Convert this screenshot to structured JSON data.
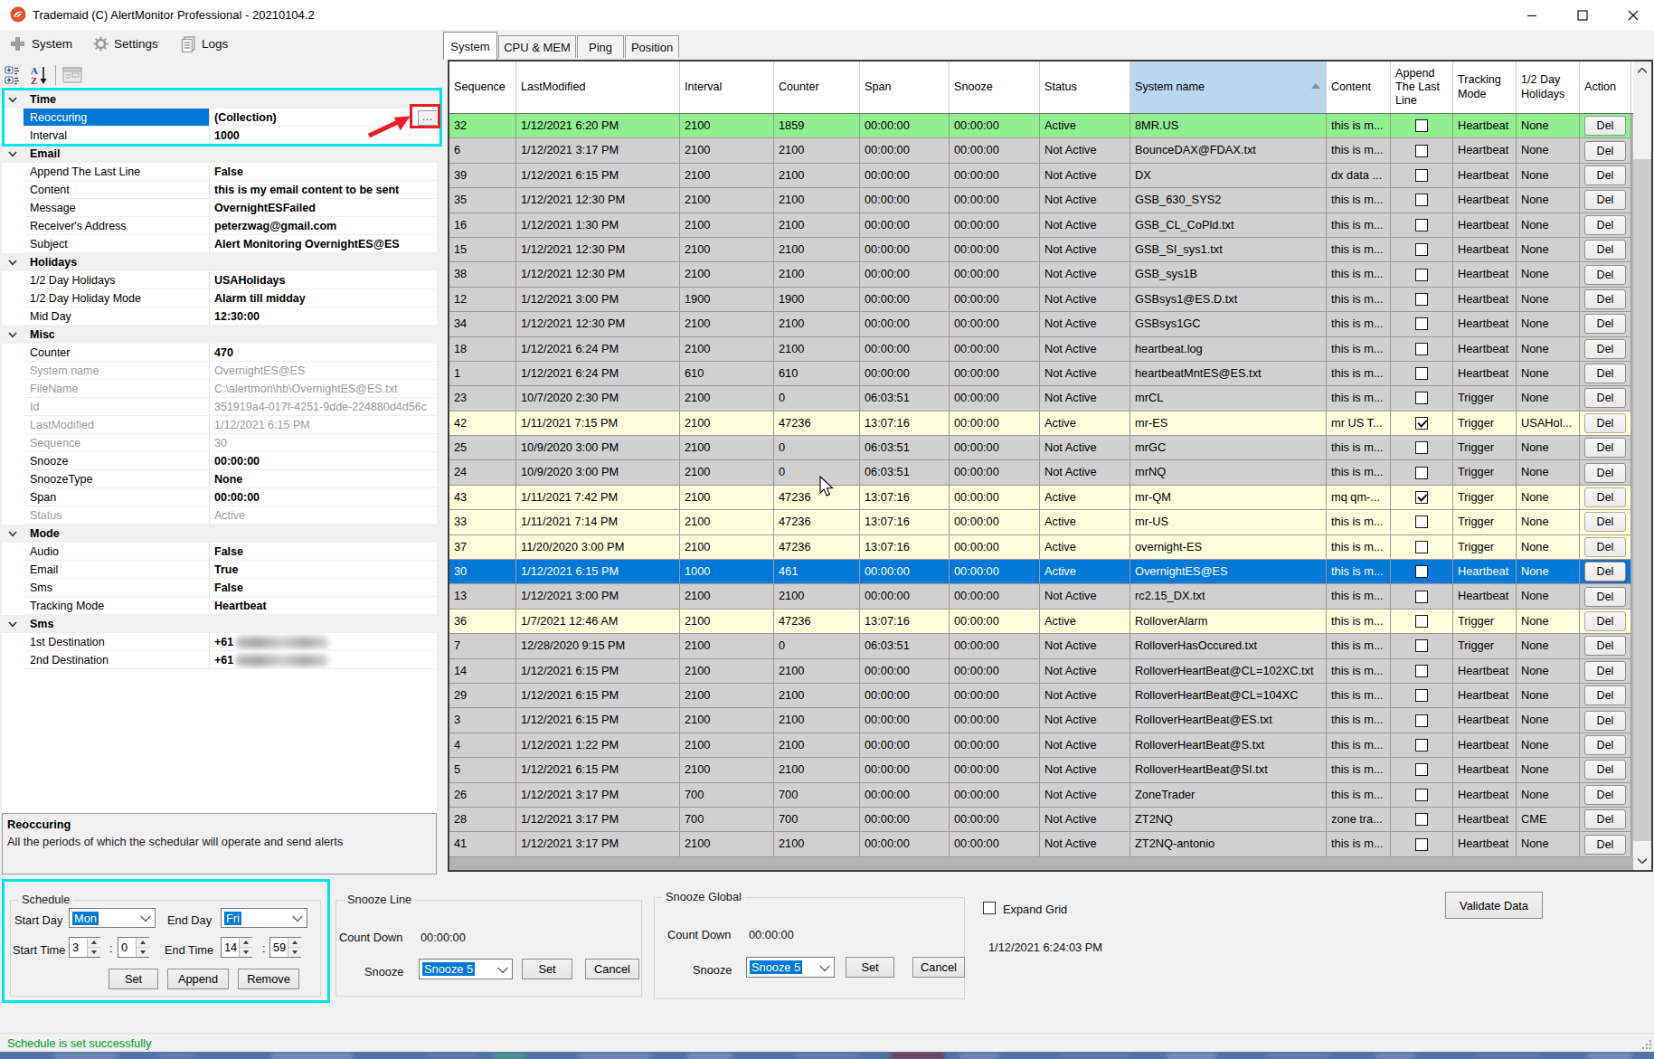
{
  "window": {
    "title": "Trademaid (C) AlertMonitor Professional - 20210104.2",
    "icon_color": "#e0512b"
  },
  "menu": {
    "items": [
      {
        "label": "System",
        "icon": "plus-icon"
      },
      {
        "label": "Settings",
        "icon": "gear-icon"
      },
      {
        "label": "Logs",
        "icon": "logs-icon"
      }
    ]
  },
  "tabs": {
    "active": "System",
    "items": [
      "System",
      "CPU & MEM",
      "Ping",
      "Position"
    ]
  },
  "property_grid": {
    "rows": [
      {
        "type": "category",
        "label": "Time"
      },
      {
        "type": "prop",
        "label": "Reoccuring",
        "value": "(Collection)",
        "bold": true,
        "selected": true,
        "ellipsis": true
      },
      {
        "type": "prop",
        "label": "Interval",
        "value": "1000",
        "bold": true
      },
      {
        "type": "category",
        "label": "Email"
      },
      {
        "type": "prop",
        "label": "Append The Last Line",
        "value": "False",
        "bold": true
      },
      {
        "type": "prop",
        "label": "Content",
        "value": "this is my email content to be sent",
        "bold": true
      },
      {
        "type": "prop",
        "label": "Message",
        "value": "OvernightESFailed",
        "bold": true
      },
      {
        "type": "prop",
        "label": "Receiver's Address",
        "value": "peterzwag@gmail.com",
        "bold": true
      },
      {
        "type": "prop",
        "label": "Subject",
        "value": "Alert Monitoring OvernightES@ES",
        "bold": true
      },
      {
        "type": "category",
        "label": "Holidays"
      },
      {
        "type": "prop",
        "label": "1/2 Day Holidays",
        "value": "USAHolidays",
        "bold": true
      },
      {
        "type": "prop",
        "label": "1/2 Day Holiday Mode",
        "value": "Alarm till midday",
        "bold": true
      },
      {
        "type": "prop",
        "label": "Mid Day",
        "value": "12:30:00",
        "bold": true
      },
      {
        "type": "category",
        "label": "Misc"
      },
      {
        "type": "prop",
        "label": "Counter",
        "value": "470",
        "bold": true
      },
      {
        "type": "prop",
        "label": "System name",
        "value": "OvernightES@ES",
        "readonly": true
      },
      {
        "type": "prop",
        "label": "FileName",
        "value": "C:\\alertmon\\hb\\OvernightES@ES.txt",
        "readonly": true
      },
      {
        "type": "prop",
        "label": "Id",
        "value": "351919a4-017f-4251-9dde-224880d4d56c",
        "readonly": true
      },
      {
        "type": "prop",
        "label": "LastModified",
        "value": "1/12/2021 6:15 PM",
        "readonly": true
      },
      {
        "type": "prop",
        "label": "Sequence",
        "value": "30",
        "readonly": true
      },
      {
        "type": "prop",
        "label": "Snooze",
        "value": "00:00:00",
        "bold": true
      },
      {
        "type": "prop",
        "label": "SnoozeType",
        "value": "None",
        "bold": true
      },
      {
        "type": "prop",
        "label": "Span",
        "value": "00:00:00",
        "bold": true
      },
      {
        "type": "prop",
        "label": "Status",
        "value": "Active",
        "readonly": true
      },
      {
        "type": "category",
        "label": "Mode"
      },
      {
        "type": "prop",
        "label": "Audio",
        "value": "False",
        "bold": true
      },
      {
        "type": "prop",
        "label": "Email",
        "value": "True",
        "bold": true
      },
      {
        "type": "prop",
        "label": "Sms",
        "value": "False",
        "bold": true
      },
      {
        "type": "prop",
        "label": "Tracking Mode",
        "value": "Heartbeat",
        "bold": true
      },
      {
        "type": "category",
        "label": "Sms"
      },
      {
        "type": "prop",
        "label": "1st Destination",
        "value": "+61",
        "bold": true,
        "masked": true
      },
      {
        "type": "prop",
        "label": "2nd Destination",
        "value": "+61",
        "bold": true,
        "masked": true
      }
    ],
    "help": {
      "title": "Reoccuring",
      "text": "All the periods of which the schedular will operate and send alerts"
    }
  },
  "grid": {
    "columns": [
      "Sequence",
      "LastModified",
      "Interval",
      "Counter",
      "Span",
      "Snooze",
      "Status",
      "System name",
      "Content",
      "Append The Last Line",
      "Tracking Mode",
      "1/2 Day Holidays",
      "Action"
    ],
    "sorted_column": "System name",
    "rows": [
      {
        "cells": [
          "32",
          "1/12/2021 6:20 PM",
          "2100",
          "1859",
          "00:00:00",
          "00:00:00",
          "Active",
          "8MR.US",
          "this is m...",
          false,
          "Heartbeat",
          "None",
          "Del"
        ],
        "color": "green"
      },
      {
        "cells": [
          "6",
          "1/12/2021 3:17 PM",
          "2100",
          "2100",
          "00:00:00",
          "00:00:00",
          "Not Active",
          "BounceDAX@FDAX.txt",
          "this is m...",
          false,
          "Heartbeat",
          "None",
          "Del"
        ],
        "color": "gray"
      },
      {
        "cells": [
          "39",
          "1/12/2021 6:15 PM",
          "2100",
          "2100",
          "00:00:00",
          "00:00:00",
          "Not Active",
          "DX",
          "dx data ...",
          false,
          "Heartbeat",
          "None",
          "Del"
        ],
        "color": "gray"
      },
      {
        "cells": [
          "35",
          "1/12/2021 12:30 PM",
          "2100",
          "2100",
          "00:00:00",
          "00:00:00",
          "Not Active",
          "GSB_630_SYS2",
          "this is m...",
          false,
          "Heartbeat",
          "None",
          "Del"
        ],
        "color": "gray"
      },
      {
        "cells": [
          "16",
          "1/12/2021 1:30 PM",
          "2100",
          "2100",
          "00:00:00",
          "00:00:00",
          "Not Active",
          "GSB_CL_CoPld.txt",
          "this is m...",
          false,
          "Heartbeat",
          "None",
          "Del"
        ],
        "color": "gray"
      },
      {
        "cells": [
          "15",
          "1/12/2021 12:30 PM",
          "2100",
          "2100",
          "00:00:00",
          "00:00:00",
          "Not Active",
          "GSB_SI_sys1.txt",
          "this is m...",
          false,
          "Heartbeat",
          "None",
          "Del"
        ],
        "color": "gray"
      },
      {
        "cells": [
          "38",
          "1/12/2021 12:30 PM",
          "2100",
          "2100",
          "00:00:00",
          "00:00:00",
          "Not Active",
          "GSB_sys1B",
          "this is m...",
          false,
          "Heartbeat",
          "None",
          "Del"
        ],
        "color": "gray"
      },
      {
        "cells": [
          "12",
          "1/12/2021 3:00 PM",
          "1900",
          "1900",
          "00:00:00",
          "00:00:00",
          "Not Active",
          "GSBsys1@ES.D.txt",
          "this is m...",
          false,
          "Heartbeat",
          "None",
          "Del"
        ],
        "color": "gray"
      },
      {
        "cells": [
          "34",
          "1/12/2021 12:30 PM",
          "2100",
          "2100",
          "00:00:00",
          "00:00:00",
          "Not Active",
          "GSBsys1GC",
          "this is m...",
          false,
          "Heartbeat",
          "None",
          "Del"
        ],
        "color": "gray"
      },
      {
        "cells": [
          "18",
          "1/12/2021 6:24 PM",
          "2100",
          "2100",
          "00:00:00",
          "00:00:00",
          "Not Active",
          "heartbeat.log",
          "this is m...",
          false,
          "Heartbeat",
          "None",
          "Del"
        ],
        "color": "gray"
      },
      {
        "cells": [
          "1",
          "1/12/2021 6:24 PM",
          "610",
          "610",
          "00:00:00",
          "00:00:00",
          "Not Active",
          "heartbeatMntES@ES.txt",
          "this is m...",
          false,
          "Heartbeat",
          "None",
          "Del"
        ],
        "color": "gray"
      },
      {
        "cells": [
          "23",
          "10/7/2020 2:30 PM",
          "2100",
          "0",
          "06:03:51",
          "00:00:00",
          "Not Active",
          "mrCL",
          "this is m...",
          false,
          "Trigger",
          "None",
          "Del"
        ],
        "color": "gray"
      },
      {
        "cells": [
          "42",
          "1/11/2021 7:15 PM",
          "2100",
          "47236",
          "13:07:16",
          "00:00:00",
          "Active",
          "mr-ES",
          "mr US T...",
          true,
          "Trigger",
          "USAHol...",
          "Del"
        ],
        "color": "yellow"
      },
      {
        "cells": [
          "25",
          "10/9/2020 3:00 PM",
          "2100",
          "0",
          "06:03:51",
          "00:00:00",
          "Not Active",
          "mrGC",
          "this is m...",
          false,
          "Trigger",
          "None",
          "Del"
        ],
        "color": "gray"
      },
      {
        "cells": [
          "24",
          "10/9/2020 3:00 PM",
          "2100",
          "0",
          "06:03:51",
          "00:00:00",
          "Not Active",
          "mrNQ",
          "this is m...",
          false,
          "Trigger",
          "None",
          "Del"
        ],
        "color": "gray"
      },
      {
        "cells": [
          "43",
          "1/11/2021 7:42 PM",
          "2100",
          "47236",
          "13:07:16",
          "00:00:00",
          "Active",
          "mr-QM",
          "mq qm-...",
          true,
          "Trigger",
          "None",
          "Del"
        ],
        "color": "yellow"
      },
      {
        "cells": [
          "33",
          "1/11/2021 7:14 PM",
          "2100",
          "47236",
          "13:07:16",
          "00:00:00",
          "Active",
          "mr-US",
          "this is m...",
          false,
          "Trigger",
          "None",
          "Del"
        ],
        "color": "yellow"
      },
      {
        "cells": [
          "37",
          "11/20/2020 3:00 PM",
          "2100",
          "47236",
          "13:07:16",
          "00:00:00",
          "Active",
          "overnight-ES",
          "this is m...",
          false,
          "Trigger",
          "None",
          "Del"
        ],
        "color": "yellow"
      },
      {
        "cells": [
          "30",
          "1/12/2021 6:15 PM",
          "1000",
          "461",
          "00:00:00",
          "00:00:00",
          "Active",
          "OvernightES@ES",
          "this is m...",
          false,
          "Heartbeat",
          "None",
          "Del"
        ],
        "color": "selected"
      },
      {
        "cells": [
          "13",
          "1/12/2021 3:00 PM",
          "2100",
          "2100",
          "00:00:00",
          "00:00:00",
          "Not Active",
          "rc2.15_DX.txt",
          "this is m...",
          false,
          "Heartbeat",
          "None",
          "Del"
        ],
        "color": "gray"
      },
      {
        "cells": [
          "36",
          "1/7/2021 12:46 AM",
          "2100",
          "47236",
          "13:07:16",
          "00:00:00",
          "Active",
          "RolloverAlarm",
          "this is m...",
          false,
          "Trigger",
          "None",
          "Del"
        ],
        "color": "yellow"
      },
      {
        "cells": [
          "7",
          "12/28/2020 9:15 PM",
          "2100",
          "0",
          "06:03:51",
          "00:00:00",
          "Not Active",
          "RolloverHasOccured.txt",
          "this is m...",
          false,
          "Trigger",
          "None",
          "Del"
        ],
        "color": "gray"
      },
      {
        "cells": [
          "14",
          "1/12/2021 6:15 PM",
          "2100",
          "2100",
          "00:00:00",
          "00:00:00",
          "Not Active",
          "RolloverHeartBeat@CL=102XC.txt",
          "this is m...",
          false,
          "Heartbeat",
          "None",
          "Del"
        ],
        "color": "gray"
      },
      {
        "cells": [
          "29",
          "1/12/2021 6:15 PM",
          "2100",
          "2100",
          "00:00:00",
          "00:00:00",
          "Not Active",
          "RolloverHeartBeat@CL=104XC",
          "this is m...",
          false,
          "Heartbeat",
          "None",
          "Del"
        ],
        "color": "gray"
      },
      {
        "cells": [
          "3",
          "1/12/2021 6:15 PM",
          "2100",
          "2100",
          "00:00:00",
          "00:00:00",
          "Not Active",
          "RolloverHeartBeat@ES.txt",
          "this is m...",
          false,
          "Heartbeat",
          "None",
          "Del"
        ],
        "color": "gray"
      },
      {
        "cells": [
          "4",
          "1/12/2021 1:22 PM",
          "2100",
          "2100",
          "00:00:00",
          "00:00:00",
          "Not Active",
          "RolloverHeartBeat@S.txt",
          "this is m...",
          false,
          "Heartbeat",
          "None",
          "Del"
        ],
        "color": "gray"
      },
      {
        "cells": [
          "5",
          "1/12/2021 6:15 PM",
          "2100",
          "2100",
          "00:00:00",
          "00:00:00",
          "Not Active",
          "RolloverHeartBeat@SI.txt",
          "this is m...",
          false,
          "Heartbeat",
          "None",
          "Del"
        ],
        "color": "gray"
      },
      {
        "cells": [
          "26",
          "1/12/2021 3:17 PM",
          "700",
          "700",
          "00:00:00",
          "00:00:00",
          "Not Active",
          "ZoneTrader",
          "this is m...",
          false,
          "Heartbeat",
          "None",
          "Del"
        ],
        "color": "gray"
      },
      {
        "cells": [
          "28",
          "1/12/2021 3:17 PM",
          "700",
          "700",
          "00:00:00",
          "00:00:00",
          "Not Active",
          "ZT2NQ",
          "zone tra...",
          false,
          "Heartbeat",
          "CME",
          "Del"
        ],
        "color": "gray"
      },
      {
        "cells": [
          "41",
          "1/12/2021 3:17 PM",
          "2100",
          "2100",
          "00:00:00",
          "00:00:00",
          "Not Active",
          "ZT2NQ-antonio",
          "this is m...",
          false,
          "Heartbeat",
          "None",
          "Del"
        ],
        "color": "gray"
      }
    ]
  },
  "schedule": {
    "group_label": "Schedule",
    "start_day_label": "Start Day",
    "start_day_value": "Mon",
    "end_day_label": "End Day",
    "end_day_value": "Fri",
    "start_time_label": "Start Time",
    "start_hour": "3",
    "start_min": "0",
    "end_time_label": "End Time",
    "end_hour": "14",
    "end_min": "59",
    "set_label": "Set",
    "append_label": "Append",
    "remove_label": "Remove"
  },
  "snooze_line": {
    "group_label": "Snooze Line",
    "countdown_label": "Count Down",
    "countdown_value": "00:00:00",
    "snooze_label": "Snooze",
    "snooze_value": "Snooze 5",
    "set_label": "Set",
    "cancel_label": "Cancel"
  },
  "snooze_global": {
    "group_label": "Snooze Global",
    "countdown_label": "Count Down",
    "countdown_value": "00:00:00",
    "snooze_label": "Snooze",
    "snooze_value": "Snooze 5",
    "set_label": "Set",
    "cancel_label": "Cancel"
  },
  "misc_controls": {
    "expand_grid_label": "Expand Grid",
    "expand_grid_checked": false,
    "datetime": "1/12/2021 6:24:03 PM",
    "validate_label": "Validate Data"
  },
  "status_bar": {
    "text": "Schedule is set successfully",
    "color": "#009e1d"
  },
  "colors": {
    "selection_blue": "#0078d7",
    "row_green": "#90ee90",
    "row_yellow": "#ffffdc",
    "row_gray": "#d0d0d0",
    "header_highlight": "#b9d7f1",
    "annotation_cyan": "#00e5ea",
    "annotation_red": "#ec1c24"
  }
}
